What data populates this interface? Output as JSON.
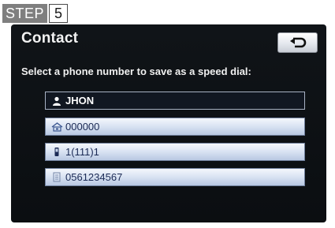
{
  "step": {
    "word": "STEP",
    "number": "5"
  },
  "screen": {
    "title": "Contact",
    "instruction": "Select a phone number to save as a speed dial:",
    "back_icon": "return-arrow-icon"
  },
  "contact": {
    "name": "JHON",
    "name_icon": "person-icon"
  },
  "numbers": [
    {
      "value": "000000",
      "icon": "home-phone-icon"
    },
    {
      "value": "1(111)1",
      "icon": "mobile-phone-icon"
    },
    {
      "value": "0561234567",
      "icon": "office-phone-icon"
    }
  ],
  "colors": {
    "screen_bg": "#0b0e11",
    "button_bg": "#d8e2f2",
    "text_light": "#f0f0f0",
    "text_dark": "#1b2a55"
  }
}
